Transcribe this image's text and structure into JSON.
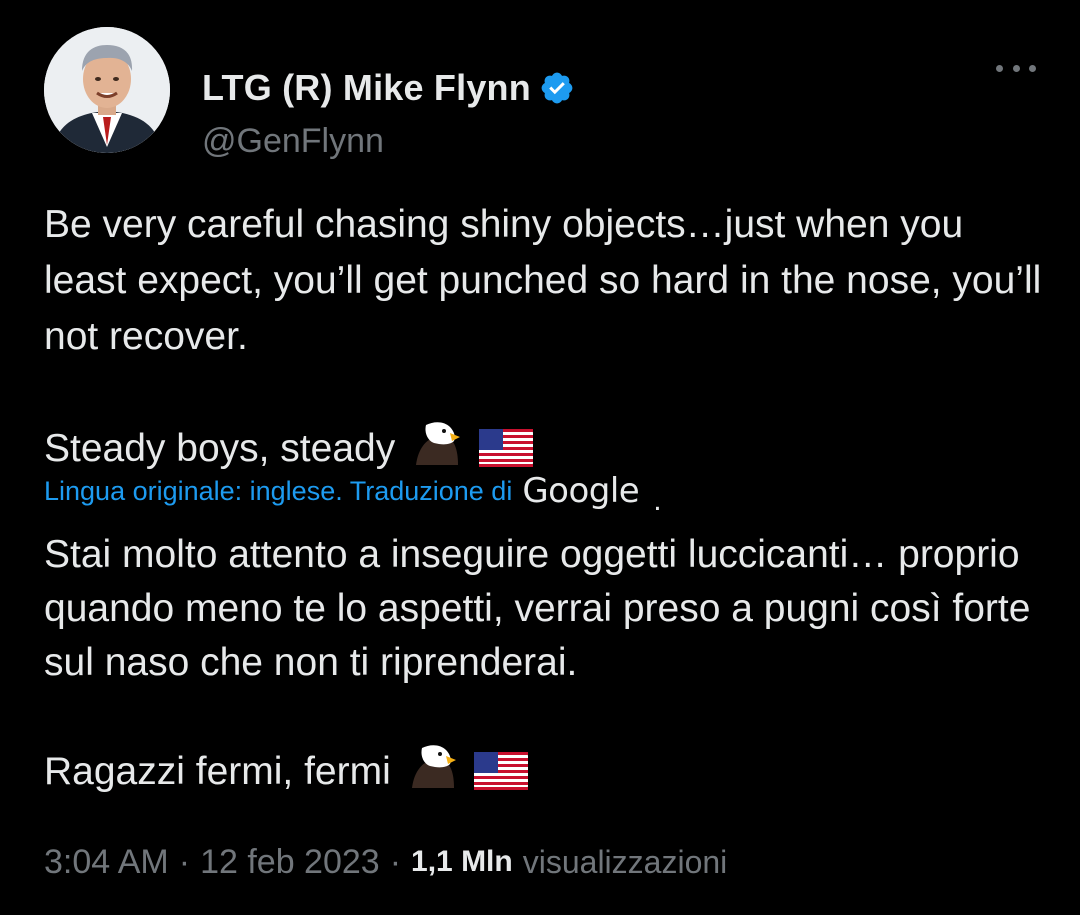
{
  "author": {
    "display_name": "LTG (R) Mike Flynn",
    "handle": "@GenFlynn",
    "verified": true,
    "verified_icon": "verified-badge-icon",
    "accent_color": "#1d9bf0"
  },
  "tweet": {
    "original_paragraph_1": "Be very careful chasing shiny objects…just when you least expect, you’ll get punched so hard in the nose, you’ll not recover.",
    "original_paragraph_2": "Steady boys, steady",
    "translation_note": "Lingua originale: inglese. Traduzione di",
    "translation_provider": "Google",
    "translation_note_suffix": ".",
    "translated_paragraph_1": "Stai molto attento a inseguire oggetti luccicanti… proprio quando meno te lo aspetti, verrai preso a pugni così forte sul naso che non ti riprenderai.",
    "translated_paragraph_2": "Ragazzi fermi, fermi",
    "emojis": [
      "eagle-emoji",
      "us-flag-emoji"
    ]
  },
  "meta": {
    "time": "3:04 AM",
    "separator": "·",
    "date": "12 feb 2023",
    "views_count": "1,1 Mln",
    "views_label": "visualizzazioni"
  },
  "colors": {
    "background": "#000000",
    "primary_text": "#e7e9ea",
    "secondary_text": "#71767b",
    "link": "#1d9bf0"
  }
}
